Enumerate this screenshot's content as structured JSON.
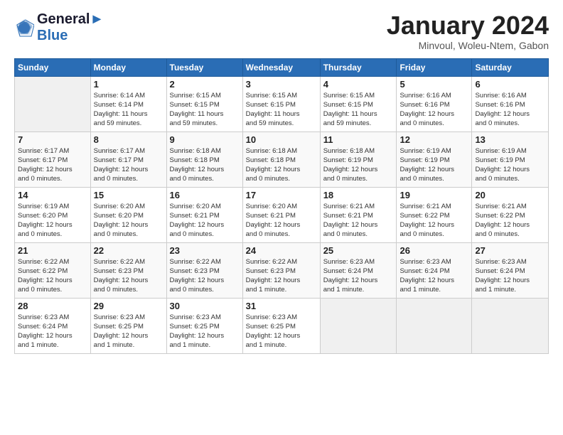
{
  "logo": {
    "line1": "General",
    "line2": "Blue"
  },
  "title": "January 2024",
  "subtitle": "Minvoul, Woleu-Ntem, Gabon",
  "days_of_week": [
    "Sunday",
    "Monday",
    "Tuesday",
    "Wednesday",
    "Thursday",
    "Friday",
    "Saturday"
  ],
  "weeks": [
    [
      {
        "day": "",
        "info": ""
      },
      {
        "day": "1",
        "info": "Sunrise: 6:14 AM\nSunset: 6:14 PM\nDaylight: 11 hours\nand 59 minutes."
      },
      {
        "day": "2",
        "info": "Sunrise: 6:15 AM\nSunset: 6:15 PM\nDaylight: 11 hours\nand 59 minutes."
      },
      {
        "day": "3",
        "info": "Sunrise: 6:15 AM\nSunset: 6:15 PM\nDaylight: 11 hours\nand 59 minutes."
      },
      {
        "day": "4",
        "info": "Sunrise: 6:15 AM\nSunset: 6:15 PM\nDaylight: 11 hours\nand 59 minutes."
      },
      {
        "day": "5",
        "info": "Sunrise: 6:16 AM\nSunset: 6:16 PM\nDaylight: 12 hours\nand 0 minutes."
      },
      {
        "day": "6",
        "info": "Sunrise: 6:16 AM\nSunset: 6:16 PM\nDaylight: 12 hours\nand 0 minutes."
      }
    ],
    [
      {
        "day": "7",
        "info": "Sunrise: 6:17 AM\nSunset: 6:17 PM\nDaylight: 12 hours\nand 0 minutes."
      },
      {
        "day": "8",
        "info": "Sunrise: 6:17 AM\nSunset: 6:17 PM\nDaylight: 12 hours\nand 0 minutes."
      },
      {
        "day": "9",
        "info": "Sunrise: 6:18 AM\nSunset: 6:18 PM\nDaylight: 12 hours\nand 0 minutes."
      },
      {
        "day": "10",
        "info": "Sunrise: 6:18 AM\nSunset: 6:18 PM\nDaylight: 12 hours\nand 0 minutes."
      },
      {
        "day": "11",
        "info": "Sunrise: 6:18 AM\nSunset: 6:19 PM\nDaylight: 12 hours\nand 0 minutes."
      },
      {
        "day": "12",
        "info": "Sunrise: 6:19 AM\nSunset: 6:19 PM\nDaylight: 12 hours\nand 0 minutes."
      },
      {
        "day": "13",
        "info": "Sunrise: 6:19 AM\nSunset: 6:19 PM\nDaylight: 12 hours\nand 0 minutes."
      }
    ],
    [
      {
        "day": "14",
        "info": "Sunrise: 6:19 AM\nSunset: 6:20 PM\nDaylight: 12 hours\nand 0 minutes."
      },
      {
        "day": "15",
        "info": "Sunrise: 6:20 AM\nSunset: 6:20 PM\nDaylight: 12 hours\nand 0 minutes."
      },
      {
        "day": "16",
        "info": "Sunrise: 6:20 AM\nSunset: 6:21 PM\nDaylight: 12 hours\nand 0 minutes."
      },
      {
        "day": "17",
        "info": "Sunrise: 6:20 AM\nSunset: 6:21 PM\nDaylight: 12 hours\nand 0 minutes."
      },
      {
        "day": "18",
        "info": "Sunrise: 6:21 AM\nSunset: 6:21 PM\nDaylight: 12 hours\nand 0 minutes."
      },
      {
        "day": "19",
        "info": "Sunrise: 6:21 AM\nSunset: 6:22 PM\nDaylight: 12 hours\nand 0 minutes."
      },
      {
        "day": "20",
        "info": "Sunrise: 6:21 AM\nSunset: 6:22 PM\nDaylight: 12 hours\nand 0 minutes."
      }
    ],
    [
      {
        "day": "21",
        "info": "Sunrise: 6:22 AM\nSunset: 6:22 PM\nDaylight: 12 hours\nand 0 minutes."
      },
      {
        "day": "22",
        "info": "Sunrise: 6:22 AM\nSunset: 6:23 PM\nDaylight: 12 hours\nand 0 minutes."
      },
      {
        "day": "23",
        "info": "Sunrise: 6:22 AM\nSunset: 6:23 PM\nDaylight: 12 hours\nand 0 minutes."
      },
      {
        "day": "24",
        "info": "Sunrise: 6:22 AM\nSunset: 6:23 PM\nDaylight: 12 hours\nand 1 minute."
      },
      {
        "day": "25",
        "info": "Sunrise: 6:23 AM\nSunset: 6:24 PM\nDaylight: 12 hours\nand 1 minute."
      },
      {
        "day": "26",
        "info": "Sunrise: 6:23 AM\nSunset: 6:24 PM\nDaylight: 12 hours\nand 1 minute."
      },
      {
        "day": "27",
        "info": "Sunrise: 6:23 AM\nSunset: 6:24 PM\nDaylight: 12 hours\nand 1 minute."
      }
    ],
    [
      {
        "day": "28",
        "info": "Sunrise: 6:23 AM\nSunset: 6:24 PM\nDaylight: 12 hours\nand 1 minute."
      },
      {
        "day": "29",
        "info": "Sunrise: 6:23 AM\nSunset: 6:25 PM\nDaylight: 12 hours\nand 1 minute."
      },
      {
        "day": "30",
        "info": "Sunrise: 6:23 AM\nSunset: 6:25 PM\nDaylight: 12 hours\nand 1 minute."
      },
      {
        "day": "31",
        "info": "Sunrise: 6:23 AM\nSunset: 6:25 PM\nDaylight: 12 hours\nand 1 minute."
      },
      {
        "day": "",
        "info": ""
      },
      {
        "day": "",
        "info": ""
      },
      {
        "day": "",
        "info": ""
      }
    ]
  ]
}
